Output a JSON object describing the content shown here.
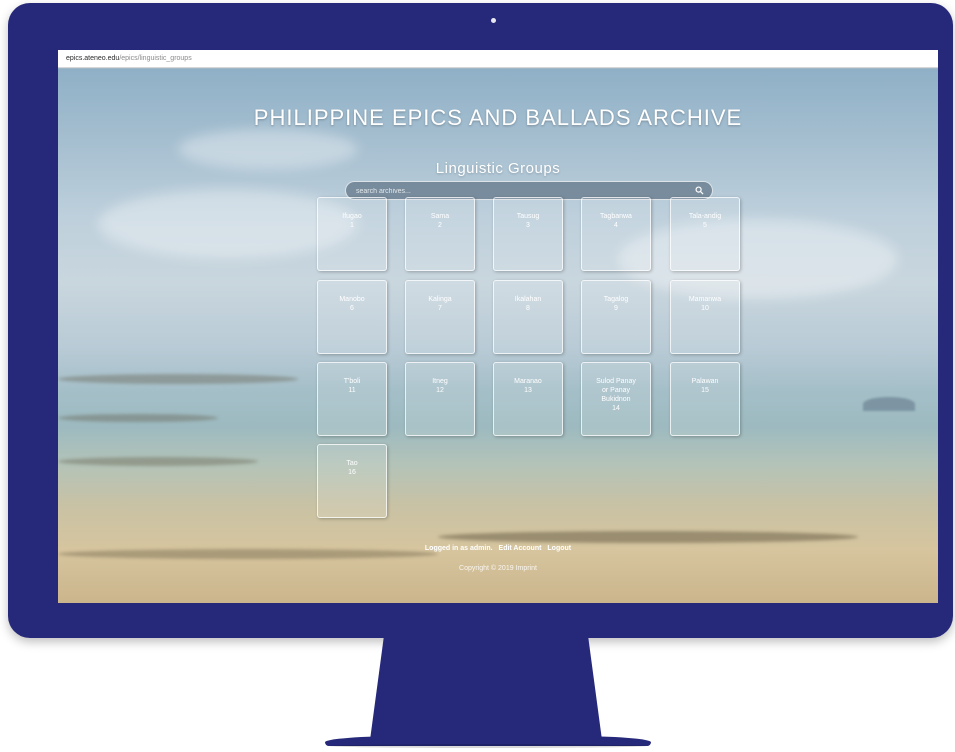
{
  "browser": {
    "url_host": "epics.ateneo.edu",
    "url_path": "/epics/linguistic_groups"
  },
  "site": {
    "title": "PHILIPPINE EPICS AND BALLADS ARCHIVE"
  },
  "main": {
    "heading": "Linguistic Groups",
    "search": {
      "placeholder": "search archives...",
      "icon": "search-icon"
    },
    "groups": [
      {
        "name": "Ifugao",
        "number": "1"
      },
      {
        "name": "Sama",
        "number": "2"
      },
      {
        "name": "Tausug",
        "number": "3"
      },
      {
        "name": "Tagbanwa",
        "number": "4"
      },
      {
        "name": "Tala-andig",
        "number": "5"
      },
      {
        "name": "Manobo",
        "number": "6"
      },
      {
        "name": "Kalinga",
        "number": "7"
      },
      {
        "name": "Ikalahan",
        "number": "8"
      },
      {
        "name": "Tagalog",
        "number": "9"
      },
      {
        "name": "Mamanwa",
        "number": "10"
      },
      {
        "name": "T'boli",
        "number": "11"
      },
      {
        "name": "Itneg",
        "number": "12"
      },
      {
        "name": "Maranao",
        "number": "13"
      },
      {
        "name": "Sulod Panay\nor Panay\nBukidnon",
        "number": "14"
      },
      {
        "name": "Palawan",
        "number": "15"
      },
      {
        "name": "Tao",
        "number": "16"
      }
    ]
  },
  "footer": {
    "logged_in": "Logged in as admin.",
    "edit_account": "Edit Account",
    "logout": "Logout",
    "copyright": "Copyright © 2019 Imprint"
  },
  "colors": {
    "monitor_frame": "#26297a",
    "text": "#ffffff"
  }
}
